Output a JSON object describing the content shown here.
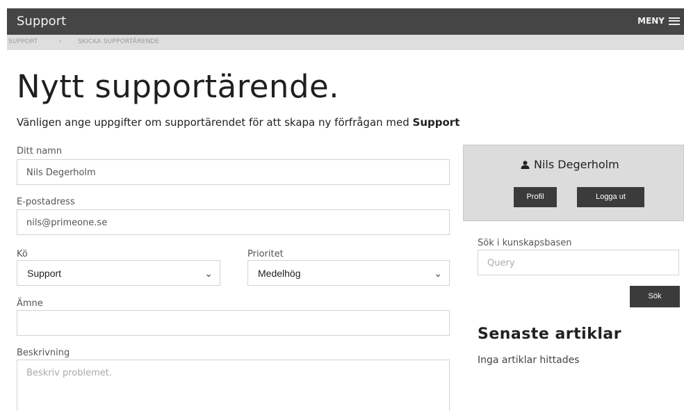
{
  "header": {
    "brand": "Support",
    "menu_label": "MENY",
    "menu_icon": "hamburger-icon"
  },
  "breadcrumb": {
    "items": [
      "SUPPORT",
      "SKICKA SUPPORTÄRENDE"
    ],
    "separator": "›"
  },
  "page": {
    "title": "Nytt supportärende.",
    "intro_prefix": "Vänligen ange uppgifter om supportärendet för att skapa ny förfrågan med ",
    "intro_bold": "Support"
  },
  "form": {
    "name": {
      "label": "Ditt namn",
      "value": "Nils Degerholm"
    },
    "email": {
      "label": "E-postadress",
      "value": "nils@primeone.se"
    },
    "queue": {
      "label": "Kö",
      "value": "Support"
    },
    "priority": {
      "label": "Prioritet",
      "value": "Medelhög"
    },
    "subject": {
      "label": "Ämne",
      "value": ""
    },
    "description": {
      "label": "Beskrivning",
      "placeholder": "Beskriv problemet."
    }
  },
  "user": {
    "name": "Nils Degerholm",
    "icon": "user-icon",
    "profile_button": "Profil",
    "logout_button": "Logga ut"
  },
  "kb": {
    "label": "Sök i kunskapsbasen",
    "placeholder": "Query",
    "search_button": "Sök"
  },
  "articles": {
    "title": "Senaste artiklar",
    "empty_text": "Inga artiklar hittades"
  }
}
